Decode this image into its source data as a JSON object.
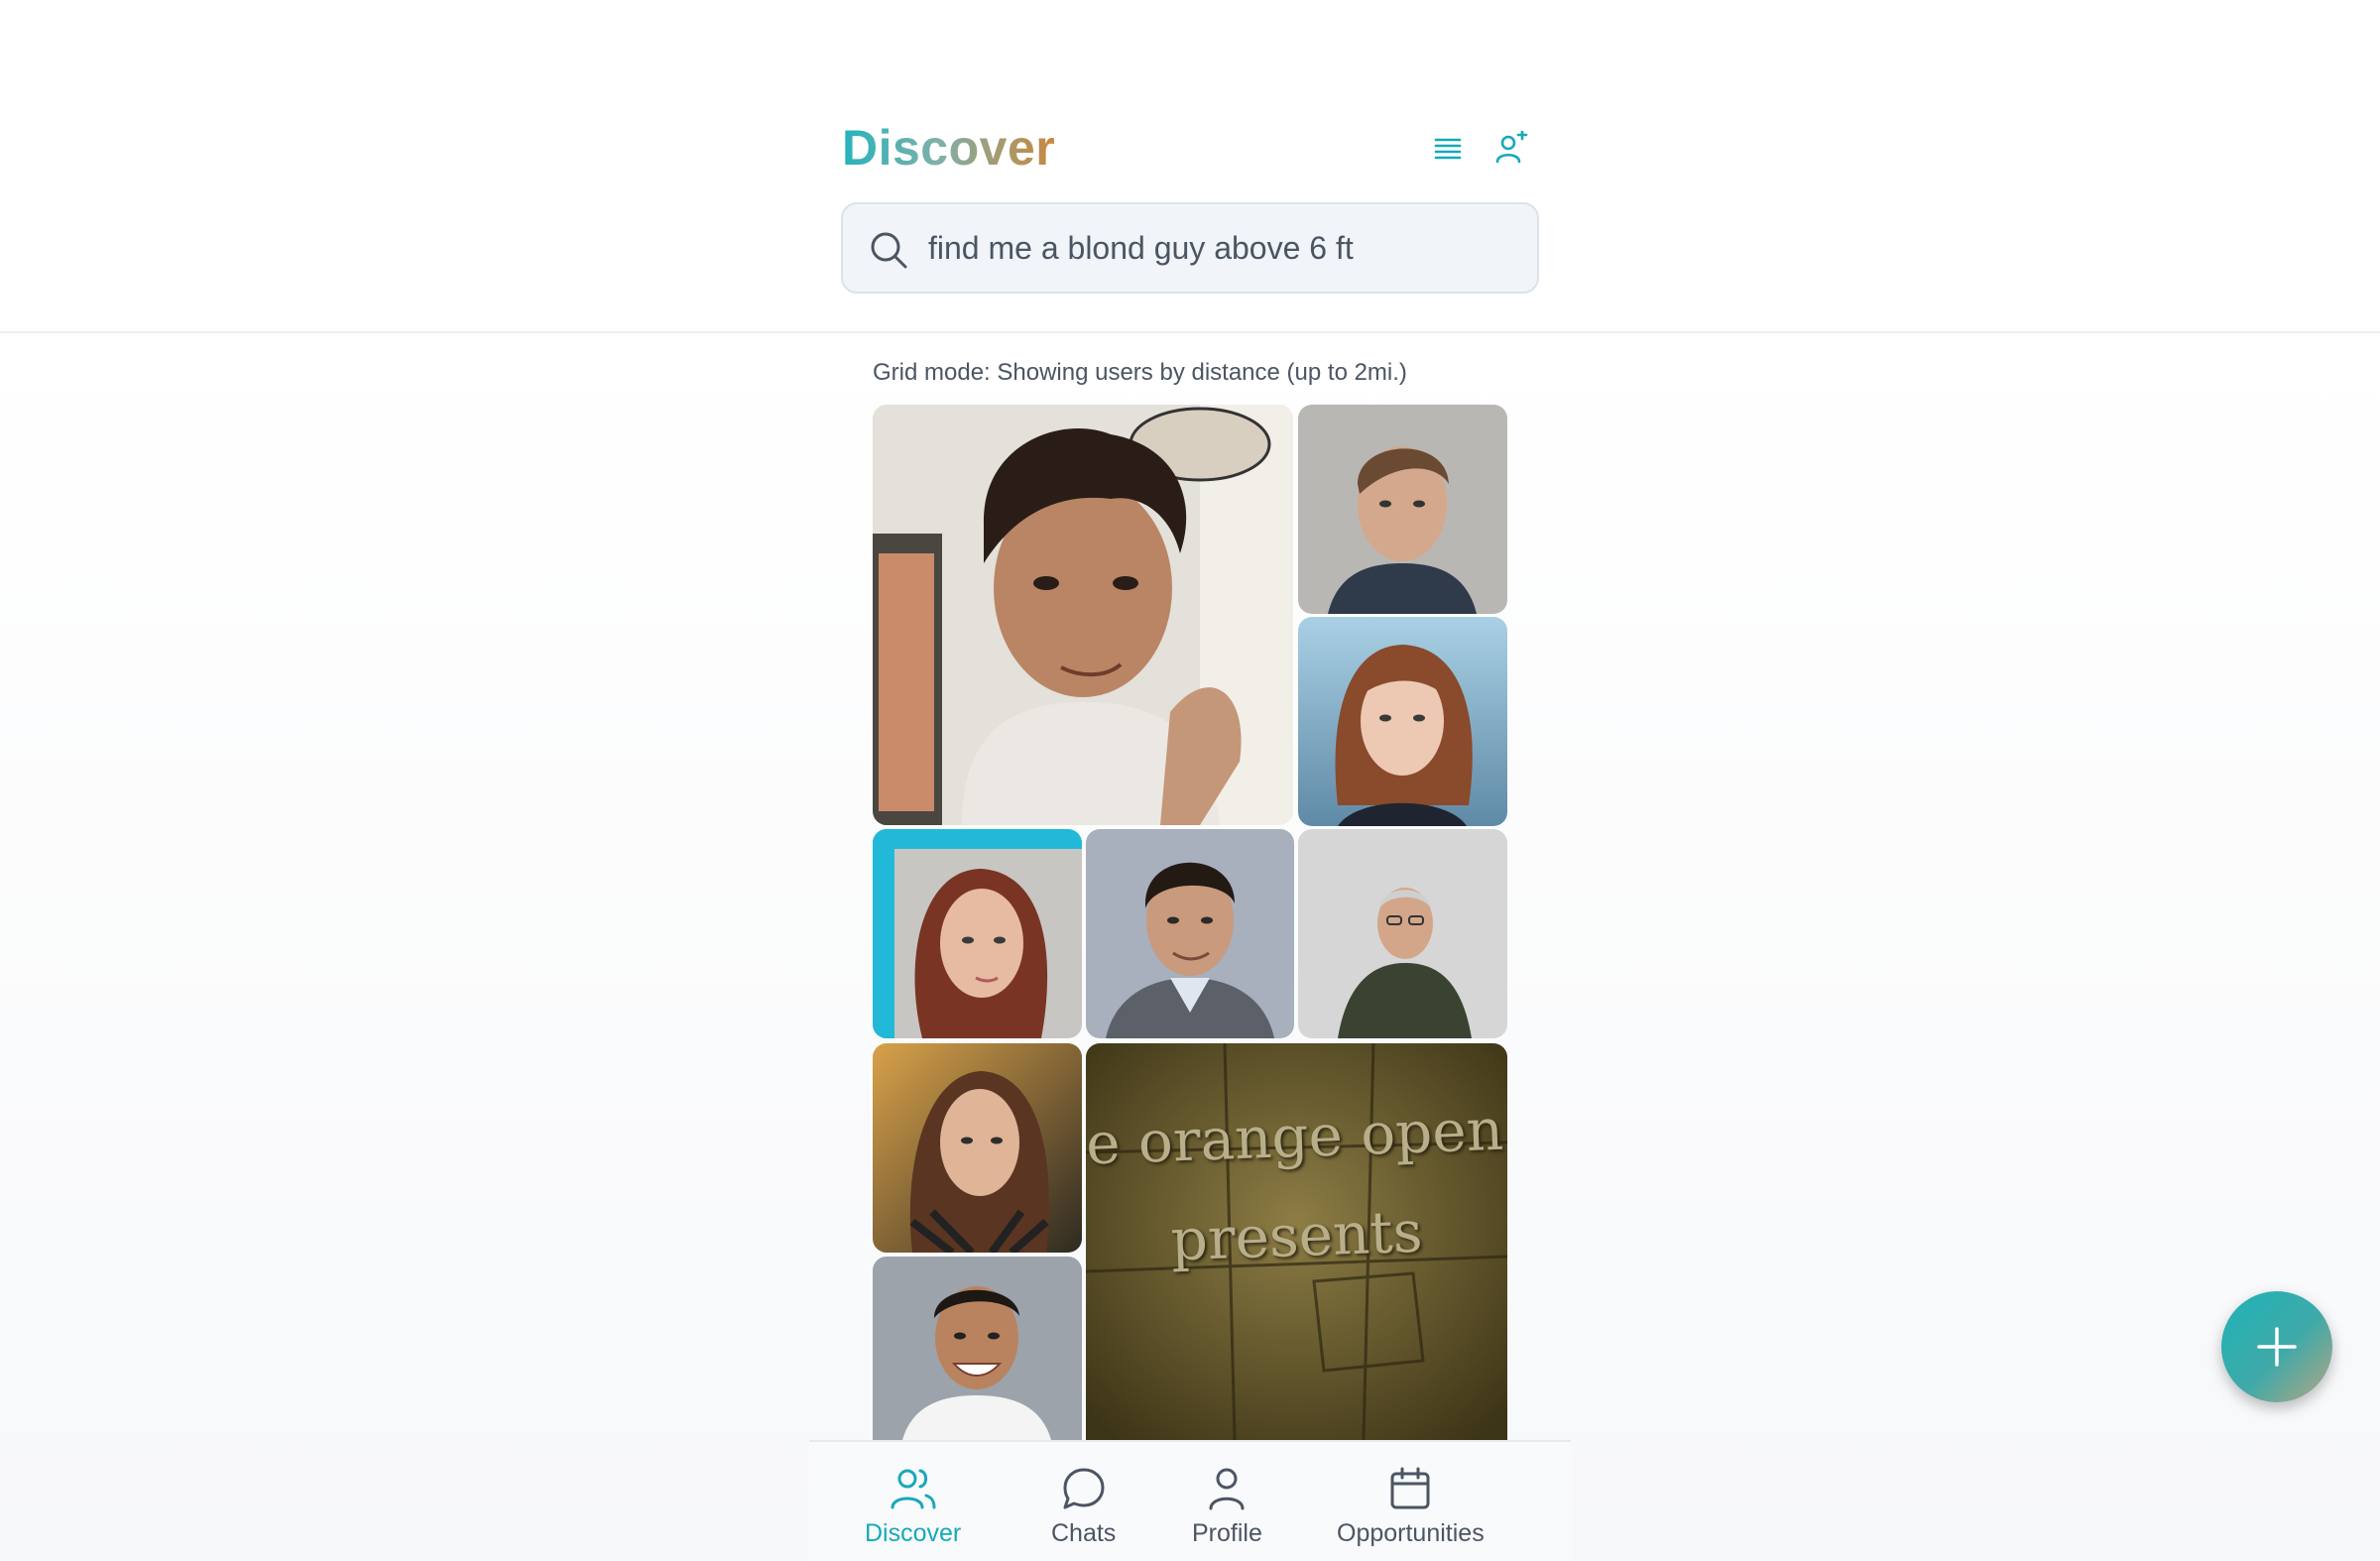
{
  "header": {
    "title": "Discover"
  },
  "search": {
    "value": "find me a blond guy above 6 ft"
  },
  "grid": {
    "caption": "Grid mode: Showing users by distance (up to 2mi.)",
    "featured_video": {
      "line1": "e orange open movie projec",
      "line2": "presents"
    }
  },
  "nav": {
    "items": [
      {
        "label": "Discover",
        "icon": "users-icon",
        "active": true
      },
      {
        "label": "Chats",
        "icon": "chat-bubble-icon",
        "active": false
      },
      {
        "label": "Profile",
        "icon": "person-icon",
        "active": false
      },
      {
        "label": "Opportunities",
        "icon": "calendar-icon",
        "active": false
      }
    ]
  },
  "colors": {
    "accent": "#17a9b8",
    "title_gradient_start": "#26b3bd",
    "title_gradient_end": "#c8873d"
  }
}
